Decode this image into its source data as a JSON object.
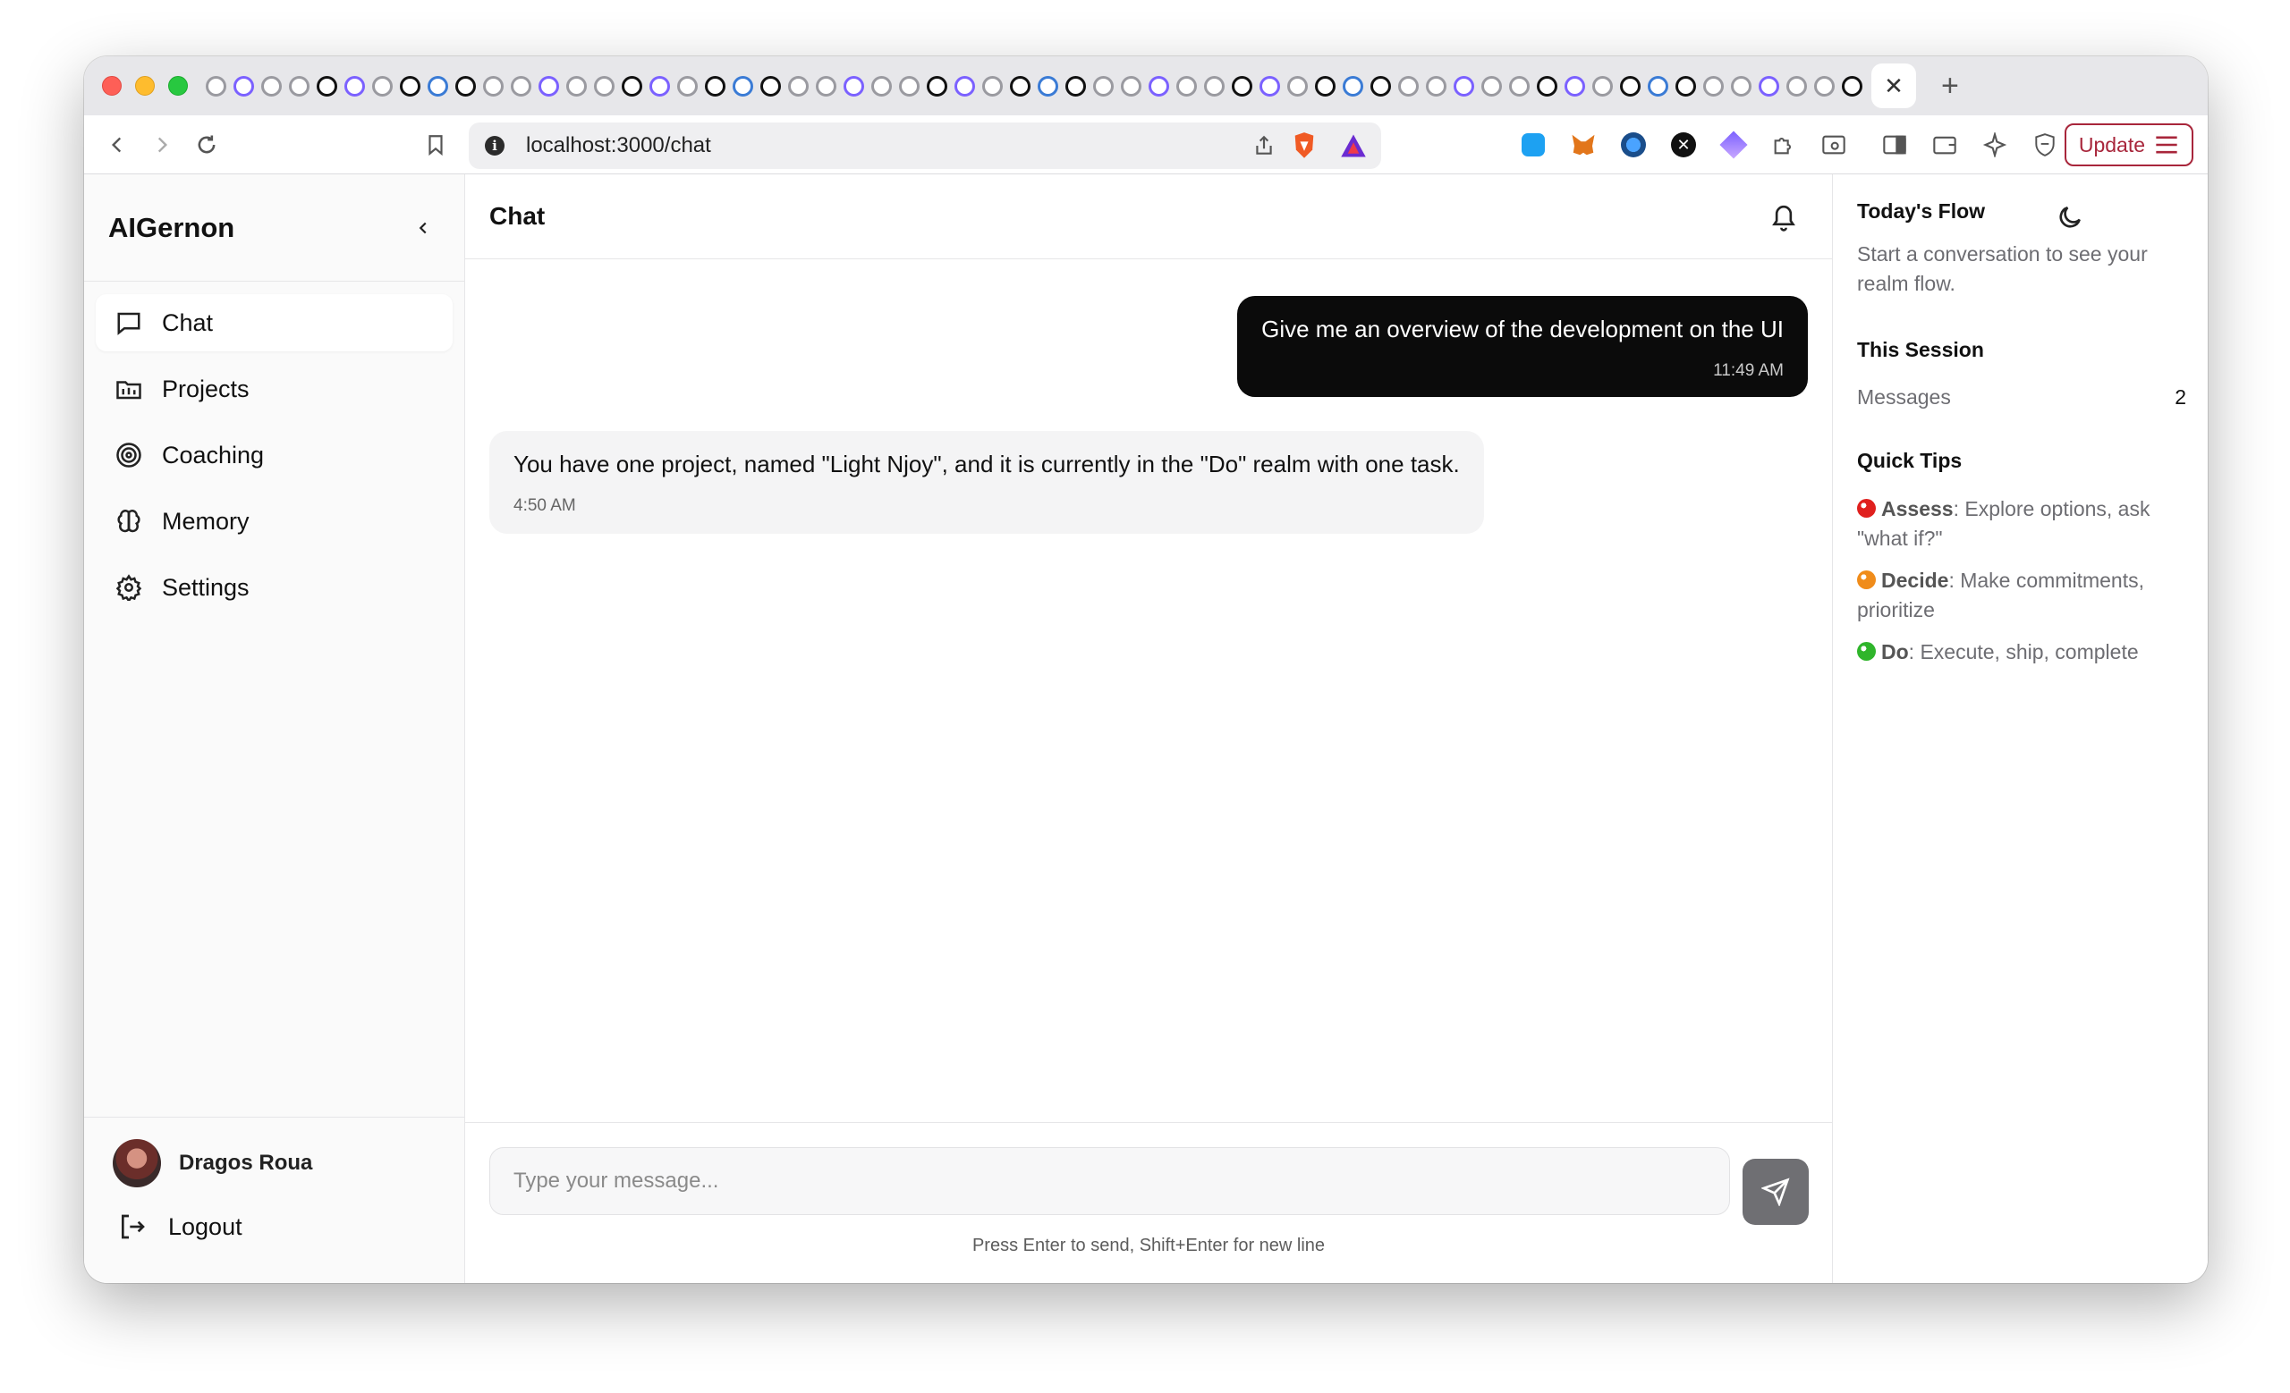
{
  "browser": {
    "url": "localhost:3000/chat",
    "update_label": "Update",
    "tab_close_glyph": "✕",
    "new_tab_glyph": "+"
  },
  "app": {
    "brand": "AIGernon",
    "nav": [
      {
        "label": "Chat",
        "icon": "chat-bubble-icon"
      },
      {
        "label": "Projects",
        "icon": "projects-icon"
      },
      {
        "label": "Coaching",
        "icon": "target-icon"
      },
      {
        "label": "Memory",
        "icon": "brain-icon"
      },
      {
        "label": "Settings",
        "icon": "gear-icon"
      }
    ],
    "user_name": "Dragos Roua",
    "logout_label": "Logout"
  },
  "chat": {
    "title": "Chat",
    "messages": [
      {
        "role": "user",
        "text": "Give me an overview of the development on the UI",
        "time": "11:49 AM"
      },
      {
        "role": "assistant",
        "text": "You have one project, named \"Light Njoy\", and it is currently in the \"Do\" realm with one task.",
        "time": "4:50 AM"
      }
    ],
    "input_placeholder": "Type your message...",
    "hint": "Press Enter to send, Shift+Enter for new line"
  },
  "right_panel": {
    "flow_title": "Today's Flow",
    "flow_text": "Start a conversation to see your realm flow.",
    "session_title": "This Session",
    "session_messages_label": "Messages",
    "session_messages_count": "2",
    "tips_title": "Quick Tips",
    "tips": [
      {
        "name": "Assess",
        "text": ": Explore options, ask \"what if?\"",
        "color": "#e0201e"
      },
      {
        "name": "Decide",
        "text": ": Make commitments, prioritize",
        "color": "#f08c1a"
      },
      {
        "name": "Do",
        "text": ": Execute, ship, complete",
        "color": "#2fb52b"
      }
    ]
  },
  "colors": {
    "accent_dark": "#0b0b0b",
    "update_red": "#a8263b"
  }
}
